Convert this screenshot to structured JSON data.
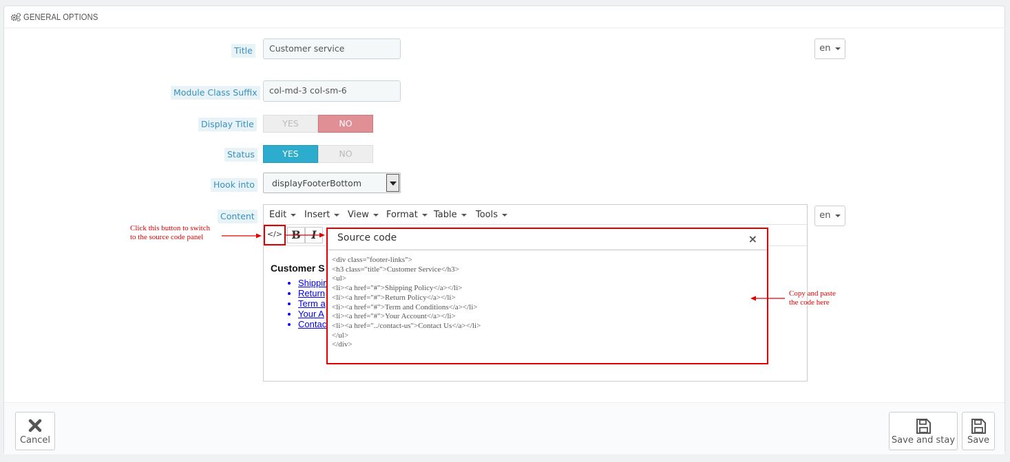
{
  "panel": {
    "title": "GENERAL OPTIONS"
  },
  "fields": {
    "title_label": "Title",
    "title_value": "Customer service",
    "suffix_label": "Module Class Suffix",
    "suffix_value": "col-md-3 col-sm-6",
    "display_title_label": "Display Title",
    "display_title_yes": "YES",
    "display_title_no": "NO",
    "display_title_value": "NO",
    "status_label": "Status",
    "status_yes": "YES",
    "status_no": "NO",
    "status_value": "YES",
    "hook_label": "Hook into",
    "hook_value": "displayFooterBottom",
    "content_label": "Content",
    "lang": "en"
  },
  "editor": {
    "menus": [
      "Edit",
      "Insert",
      "View",
      "Format",
      "Table",
      "Tools"
    ],
    "source_btn": "</>",
    "bold": "B",
    "italic": "I",
    "content_heading": "Customer S",
    "content_items": [
      "Shippin",
      "Return",
      "Term a",
      "Your A",
      "Contac"
    ]
  },
  "dialog": {
    "title": "Source code",
    "close": "×",
    "code": "<div class=\"footer-links\">\n<h3 class=\"title\">Customer Service</h3>\n<ul>\n<li><a href=\"#\">Shipping Policy</a></li>\n<li><a href=\"#\">Return Policy</a></li>\n<li><a href=\"#\">Term and Conditions</a></li>\n<li><a href=\"#\">Your Account</a></li>\n<li><a href=\"../contact-us\">Contact Us</a></li>\n</ul>\n</div>"
  },
  "annotations": {
    "left_line1": "Click this button to switch",
    "left_line2": "to the source code panel",
    "right_line1": "Copy and paste",
    "right_line2": "the code here",
    "color": "#e00000"
  },
  "footer": {
    "cancel": "Cancel",
    "save_stay": "Save and stay",
    "save": "Save"
  },
  "colors": {
    "accent": "#2eacce",
    "no_on": "#e08f95",
    "label_bg": "#e8f3f8",
    "label_text": "#3790bd"
  }
}
